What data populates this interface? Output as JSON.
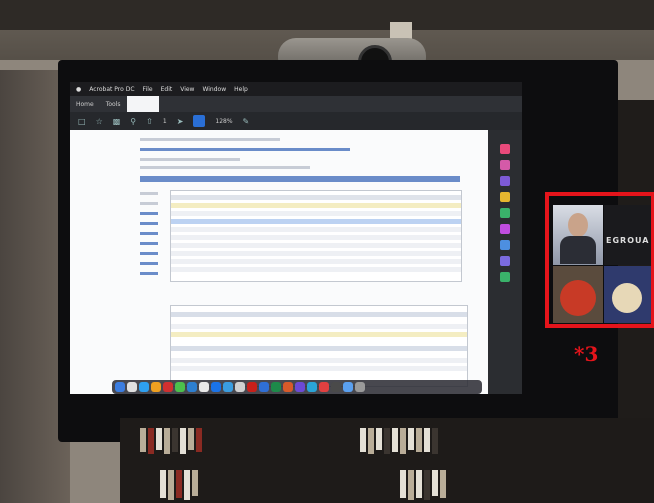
{
  "menubar": {
    "app": "Acrobat Pro DC",
    "items": [
      "File",
      "Edit",
      "View",
      "Window",
      "Help"
    ]
  },
  "tabs": [
    "Home",
    "Tools"
  ],
  "toolbar": {
    "page": "1",
    "zoom": "128%"
  },
  "call_panel": {
    "participant_label": "EGROUA"
  },
  "annotation": {
    "marker": "*3",
    "color": "#e5141b"
  }
}
